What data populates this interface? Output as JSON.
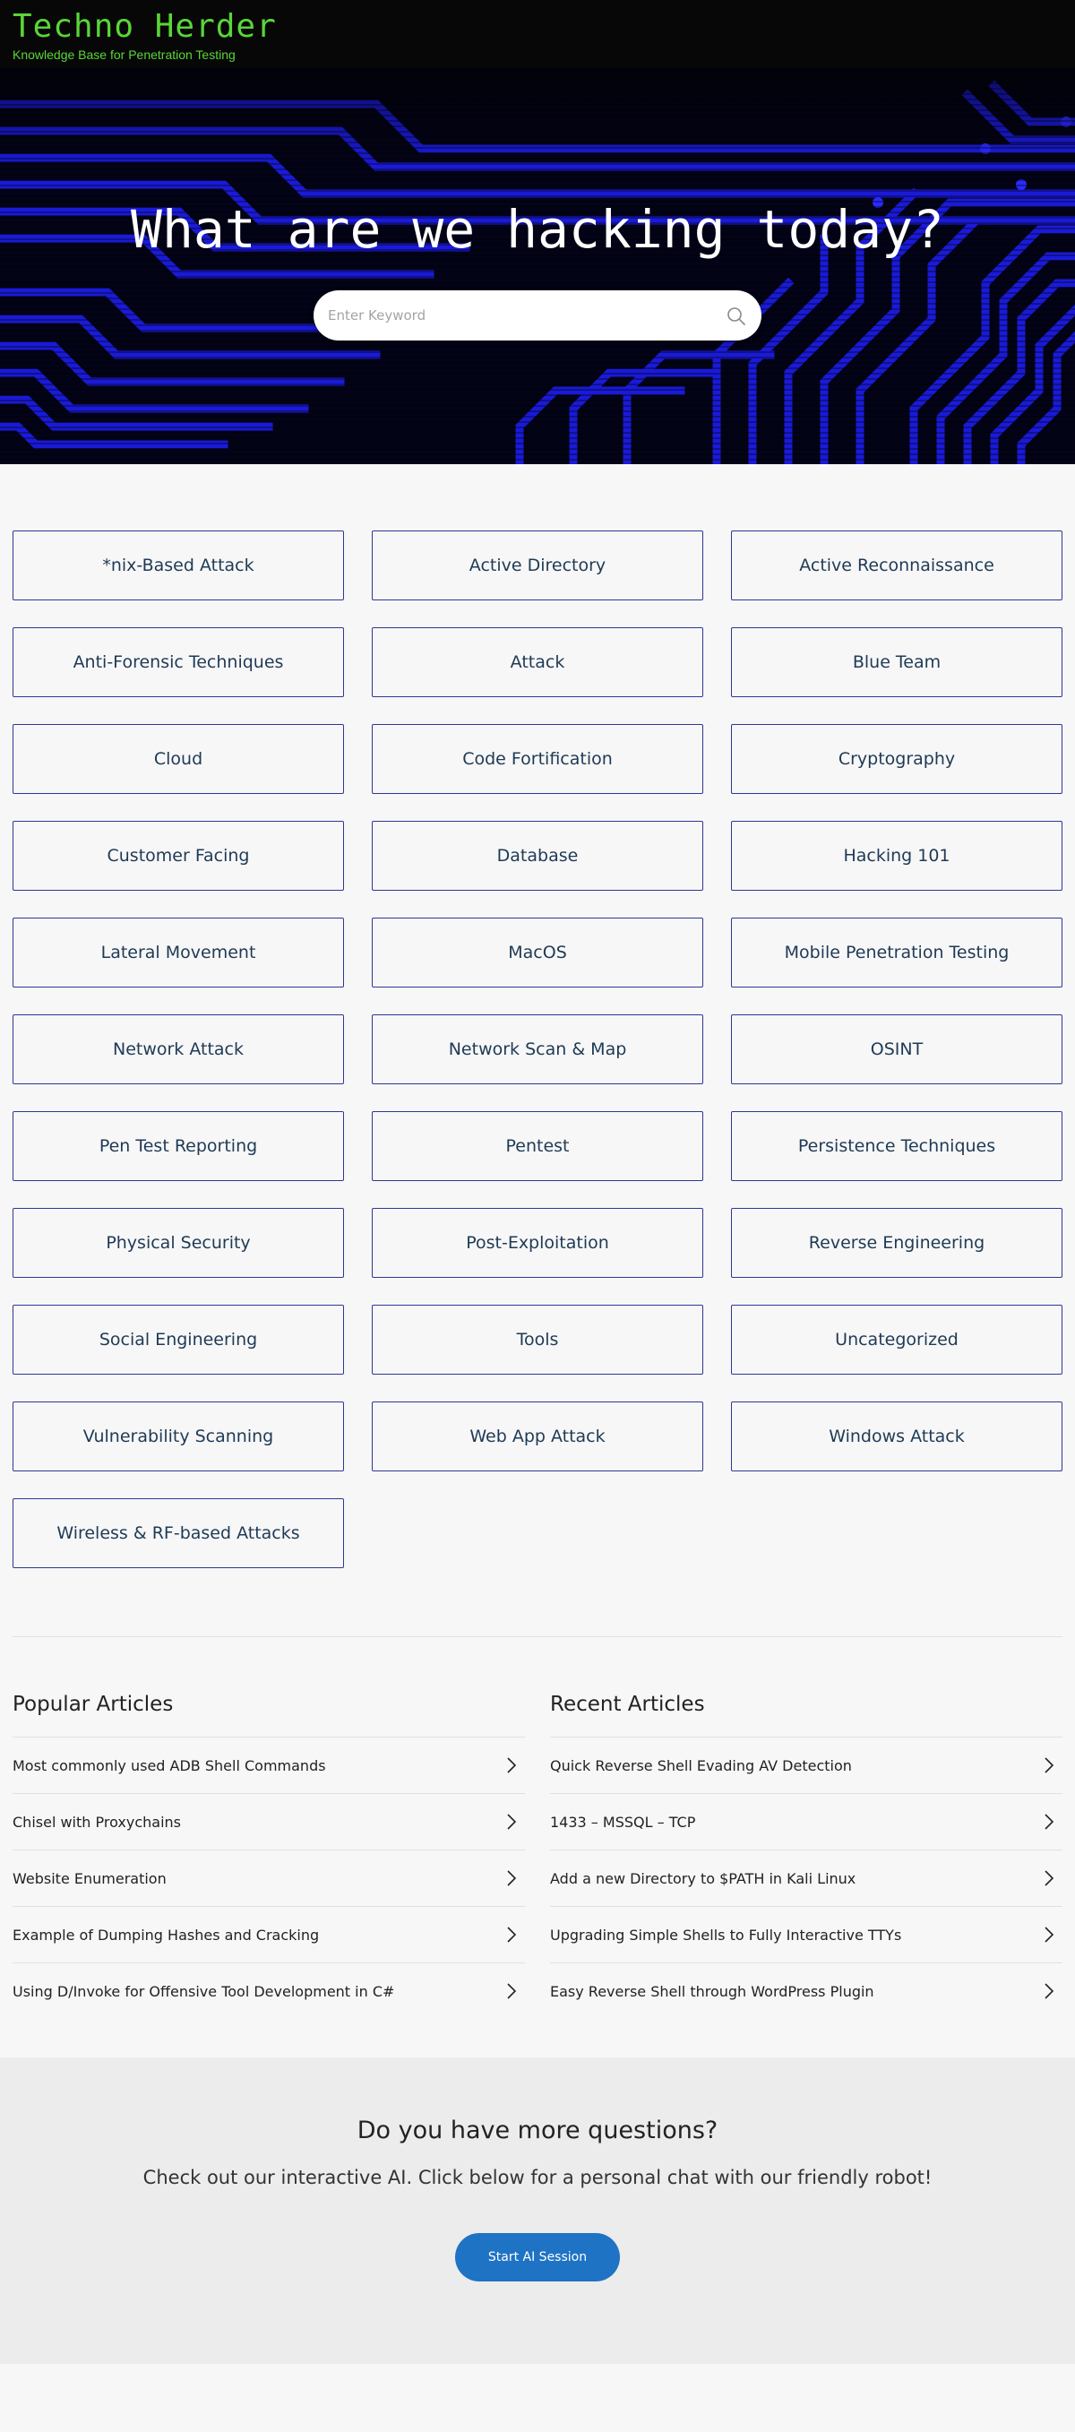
{
  "header": {
    "brand": "Techno Herder",
    "tagline": "Knowledge Base for Penetration Testing"
  },
  "hero": {
    "title": "What are we hacking today?",
    "search_placeholder": "Enter Keyword",
    "search_icon": "search-icon"
  },
  "categories": [
    "*nix-Based Attack",
    "Active Directory",
    "Active Reconnaissance",
    "Anti-Forensic Techniques",
    "Attack",
    "Blue Team",
    "Cloud",
    "Code Fortification",
    "Cryptography",
    "Customer Facing",
    "Database",
    "Hacking 101",
    "Lateral Movement",
    "MacOS",
    "Mobile Penetration Testing",
    "Network Attack",
    "Network Scan & Map",
    "OSINT",
    "Pen Test Reporting",
    "Pentest",
    "Persistence Techniques",
    "Physical Security",
    "Post-Exploitation",
    "Reverse Engineering",
    "Social Engineering",
    "Tools",
    "Uncategorized",
    "Vulnerability Scanning",
    "Web App Attack",
    "Windows Attack",
    "Wireless & RF-based Attacks"
  ],
  "popular": {
    "title": "Popular Articles",
    "items": [
      "Most commonly used ADB Shell Commands",
      "Chisel with Proxychains",
      "Website Enumeration",
      "Example of Dumping Hashes and Cracking",
      "Using D/Invoke for Offensive Tool Development in C#"
    ]
  },
  "recent": {
    "title": "Recent Articles",
    "items": [
      "Quick Reverse Shell Evading AV Detection",
      "1433 – MSSQL – TCP",
      "Add a new Directory to $PATH in Kali Linux",
      "Upgrading Simple Shells to Fully Interactive TTYs",
      "Easy Reverse Shell through WordPress Plugin"
    ]
  },
  "cta": {
    "title": "Do you have more questions?",
    "subtitle": "Check out our interactive AI. Click below for a personal chat with our friendly robot!",
    "button": "Start AI Session"
  },
  "colors": {
    "brand_green": "#59d638",
    "category_border": "#2f3694",
    "button_blue": "#1f73c4"
  }
}
